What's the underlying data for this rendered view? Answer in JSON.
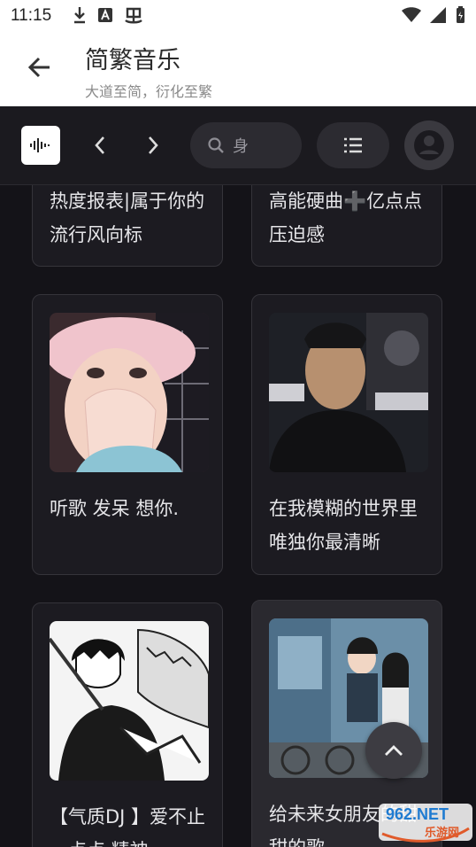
{
  "status_bar": {
    "time": "11:15"
  },
  "header": {
    "title": "简繁音乐",
    "subtitle": "大道至简，衍化至繁"
  },
  "toolbar": {
    "search_value": "身",
    "icons": [
      "back-arrow-icon",
      "waveform-logo-icon",
      "chevron-left-icon",
      "chevron-right-icon",
      "search-icon",
      "list-icon",
      "account-icon"
    ]
  },
  "cards": [
    {
      "title": "热度报表|属于你的流行风向标"
    },
    {
      "title": "高能硬曲➕亿点点压迫感"
    },
    {
      "title": "听歌 发呆 想你."
    },
    {
      "title": "在我模糊的世界里 唯独你最清晰"
    },
    {
      "title": "【气质DJ 】爱不止一点点 精神"
    },
    {
      "title": "给未来女朋友的甜甜的歌"
    }
  ],
  "watermark": {
    "brand": "962.NET",
    "sub": "乐游网"
  },
  "colors": {
    "background": "#141318",
    "card": "#1c1b21",
    "card_border": "#35343a",
    "text": "#e6e6e9"
  }
}
